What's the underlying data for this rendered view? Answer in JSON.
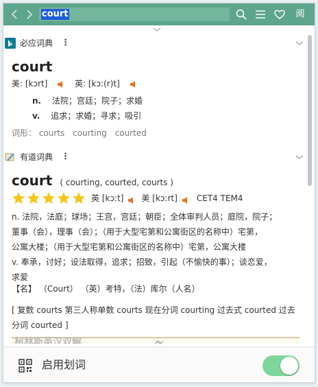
{
  "topbar": {
    "search_value": "court",
    "read_label": "阅",
    "accent_color": "#5ea58d"
  },
  "bing": {
    "name": "必应词典",
    "word": "court",
    "phon_us_label": "美: [kɔrt]",
    "phon_uk_label": "英: [kɔː(r)t]",
    "senses": [
      {
        "pos": "n.",
        "def": "法院；宫廷；院子；求婚"
      },
      {
        "pos": "v.",
        "def": "追求；求婚；寻求；吸引"
      }
    ],
    "forms_label": "词形：",
    "forms": [
      "courts",
      "courting",
      "courted"
    ]
  },
  "youdao": {
    "name": "有道词典",
    "word": "court",
    "forms_paren": "( courting, courted, courts )",
    "rating_stars": 5,
    "phon_uk": "英 [kɔːt]",
    "phon_us": "美 [kɔːrt]",
    "levels": "CET4 TEM4",
    "lines": [
      "n. 法院，法庭；球场；王宫，宫廷；朝臣；全体审判人员；庭院，院子；",
      "董事（会），理事（会）；（用于大型宅第和公寓街区的名称中）宅第，",
      "公寓大楼；（用于大型宅第和公寓街区的名称中）宅第，公寓大楼",
      "v. 奉承，讨好；设法取得，追求；招致，引起（不愉快的事）；谈恋爱，",
      "求爱"
    ],
    "name_entry": "【名】 （Court） （英）考特，（法）库尔（人名）",
    "inflection_line1": "[ 复数 courts 第三人称单数 courts 现在分词 courting 过去式 courted 过去",
    "inflection_line2": "分词 courted ]"
  },
  "collins": {
    "name": "柯林斯英汉双解"
  },
  "bottom": {
    "label": "启用划词",
    "toggle_on": true,
    "toggle_color": "#7dd79b"
  }
}
